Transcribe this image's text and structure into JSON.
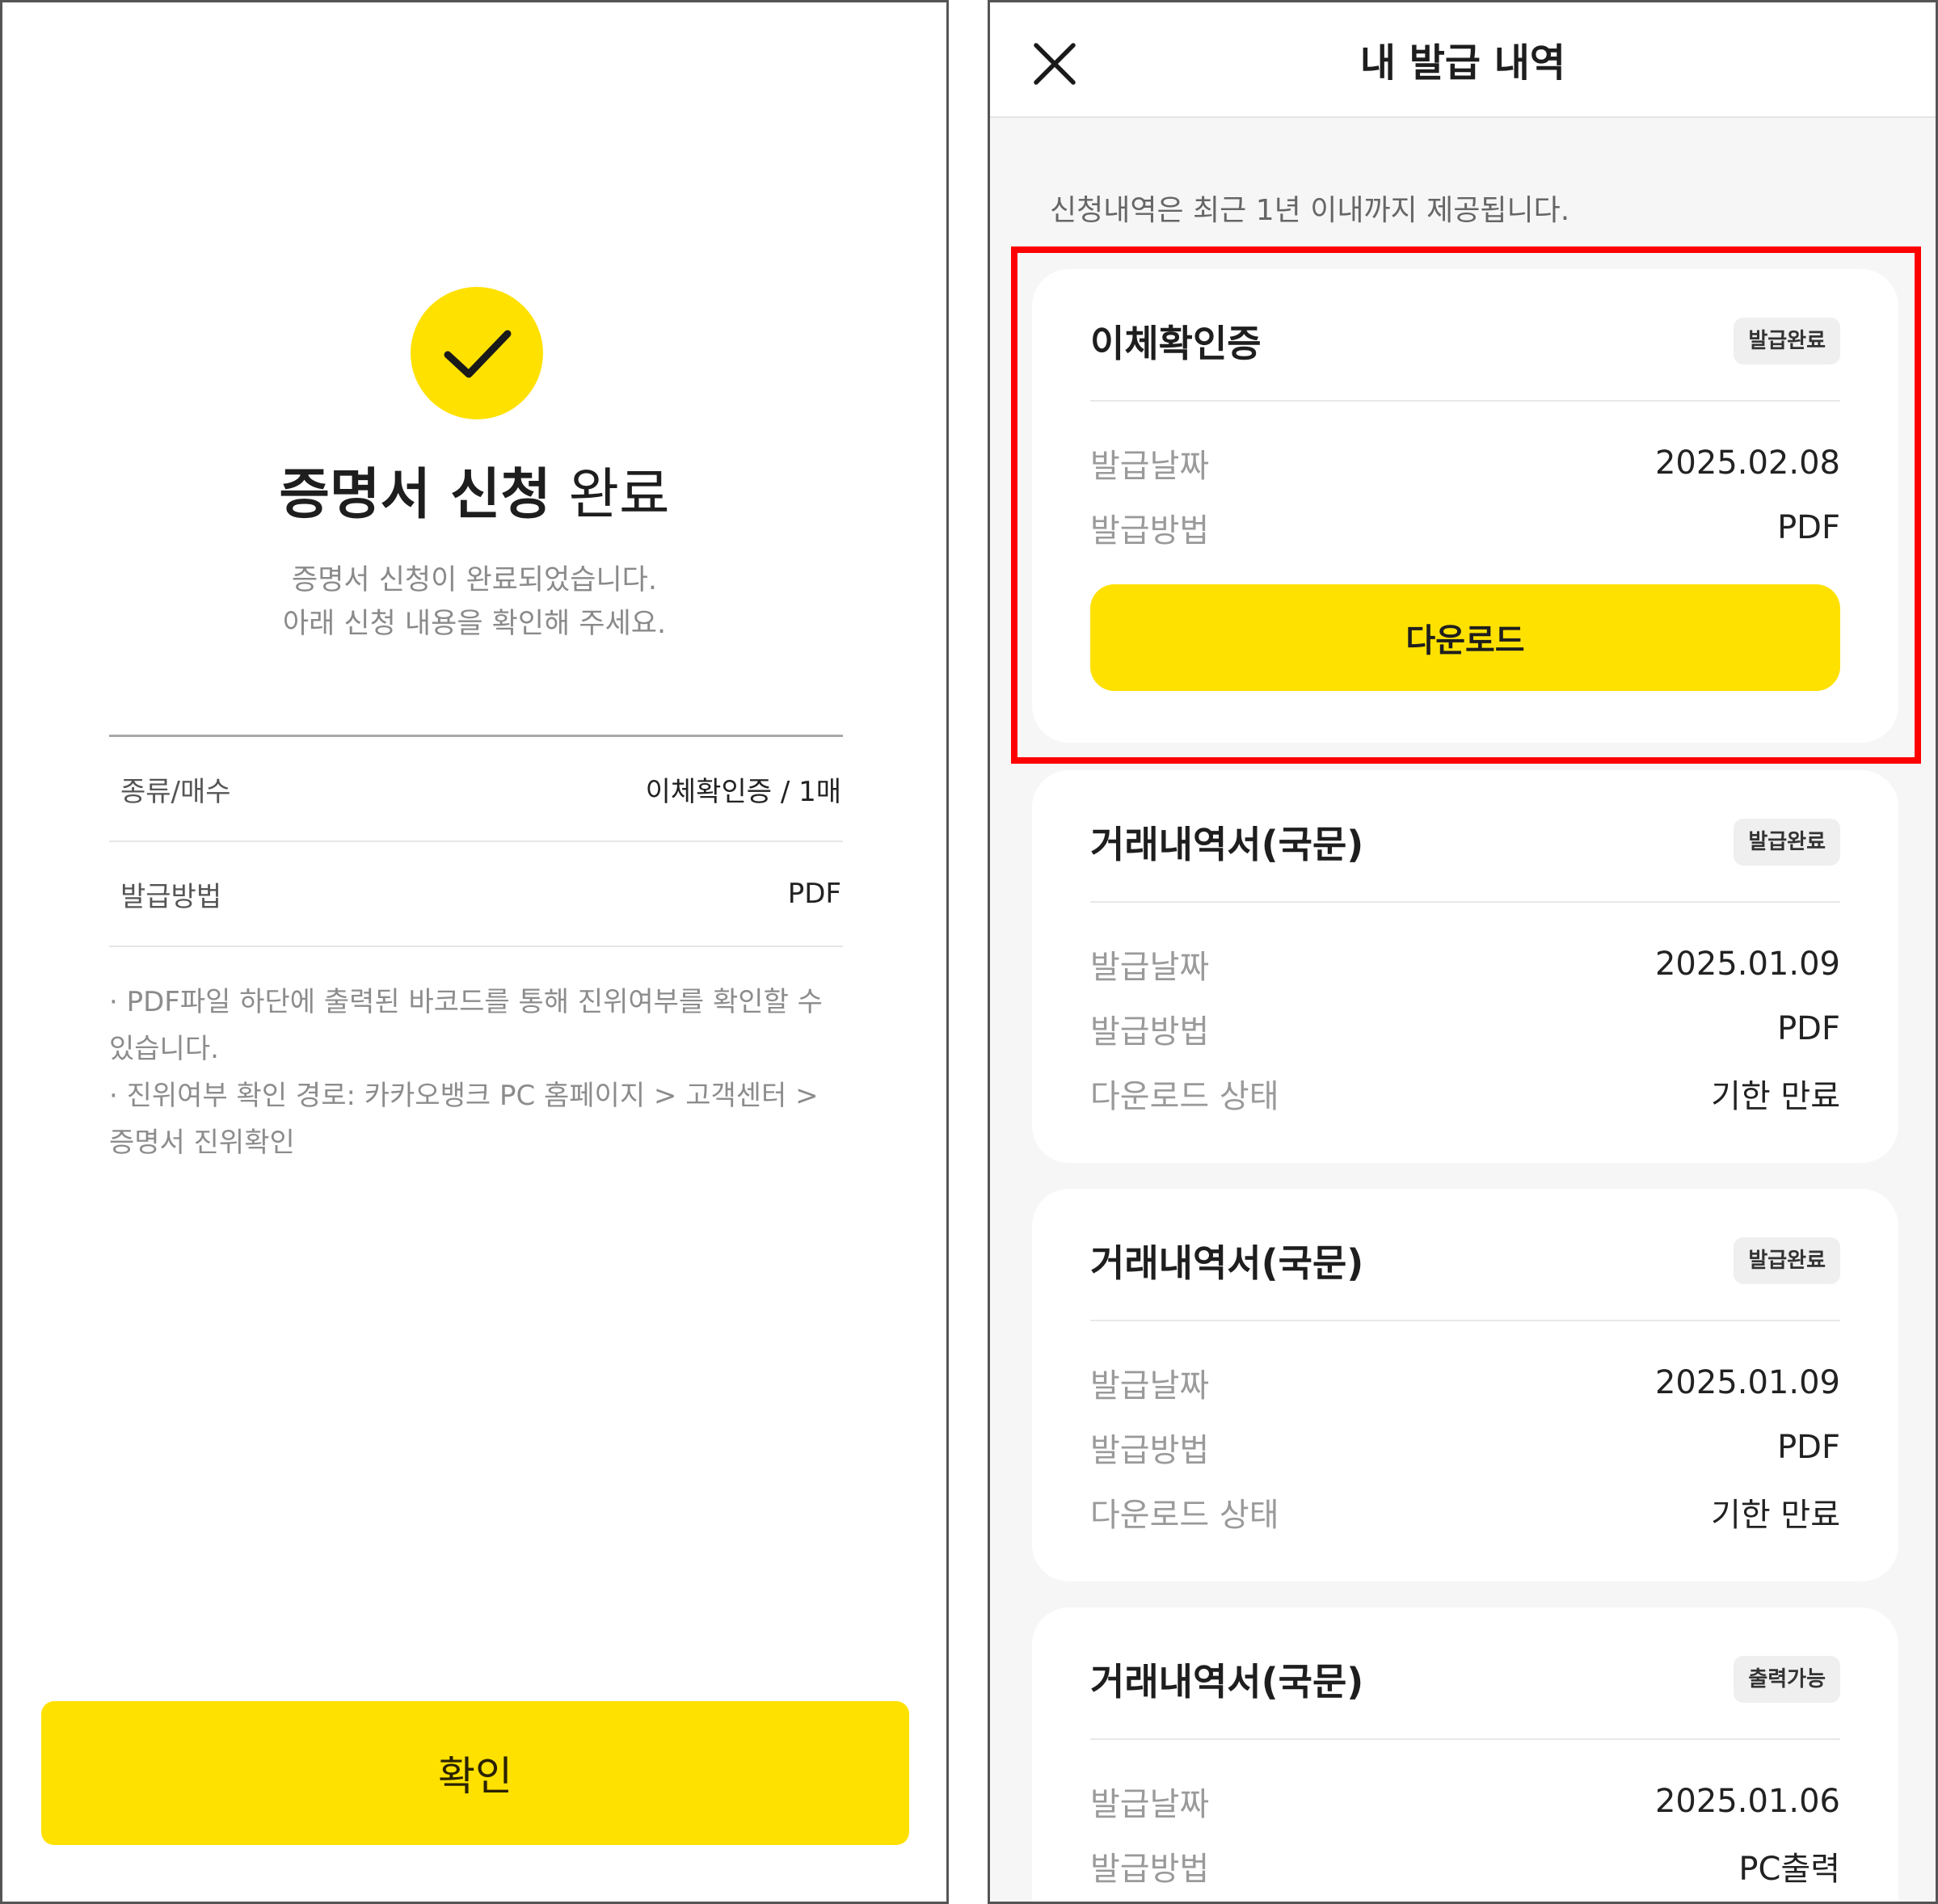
{
  "left": {
    "title_bold": "증명서 신청",
    "title_regular": " 완료",
    "desc_lines": [
      "증명서 신청이 완료되었습니다.",
      "아래 신청 내용을 확인해 주세요."
    ],
    "rows": [
      {
        "label": "종류/매수",
        "value": "이체확인증 / 1매"
      },
      {
        "label": "발급방법",
        "value": "PDF"
      }
    ],
    "notes": [
      "· PDF파일 하단에 출력된 바코드를 통해 진위여부를 확인할 수 있습니다.",
      "· 진위여부 확인 경로: 카카오뱅크 PC 홈페이지 > 고객센터 > 증명서 진위확인"
    ],
    "confirm_label": "확인",
    "check_icon": "check-icon",
    "accent_color": "#FFE100"
  },
  "right": {
    "title": "내 발급 내역",
    "close_icon": "close-icon",
    "notice": "신청내역은 최근 1년 이내까지 제공됩니다.",
    "highlight_color": "#FF0000",
    "cards": [
      {
        "title": "이체확인증",
        "badge": "발급완료",
        "fields": [
          {
            "k": "발급날짜",
            "v": "2025.02.08"
          },
          {
            "k": "발급방법",
            "v": "PDF"
          }
        ],
        "button": "다운로드"
      },
      {
        "title": "거래내역서(국문)",
        "badge": "발급완료",
        "fields": [
          {
            "k": "발급날짜",
            "v": "2025.01.09"
          },
          {
            "k": "발급방법",
            "v": "PDF"
          },
          {
            "k": "다운로드 상태",
            "v": "기한 만료"
          }
        ]
      },
      {
        "title": "거래내역서(국문)",
        "badge": "발급완료",
        "fields": [
          {
            "k": "발급날짜",
            "v": "2025.01.09"
          },
          {
            "k": "발급방법",
            "v": "PDF"
          },
          {
            "k": "다운로드 상태",
            "v": "기한 만료"
          }
        ]
      },
      {
        "title": "거래내역서(국문)",
        "badge": "출력가능",
        "fields": [
          {
            "k": "발급날짜",
            "v": "2025.01.06"
          },
          {
            "k": "발급방법",
            "v": "PC출력"
          }
        ]
      }
    ]
  }
}
